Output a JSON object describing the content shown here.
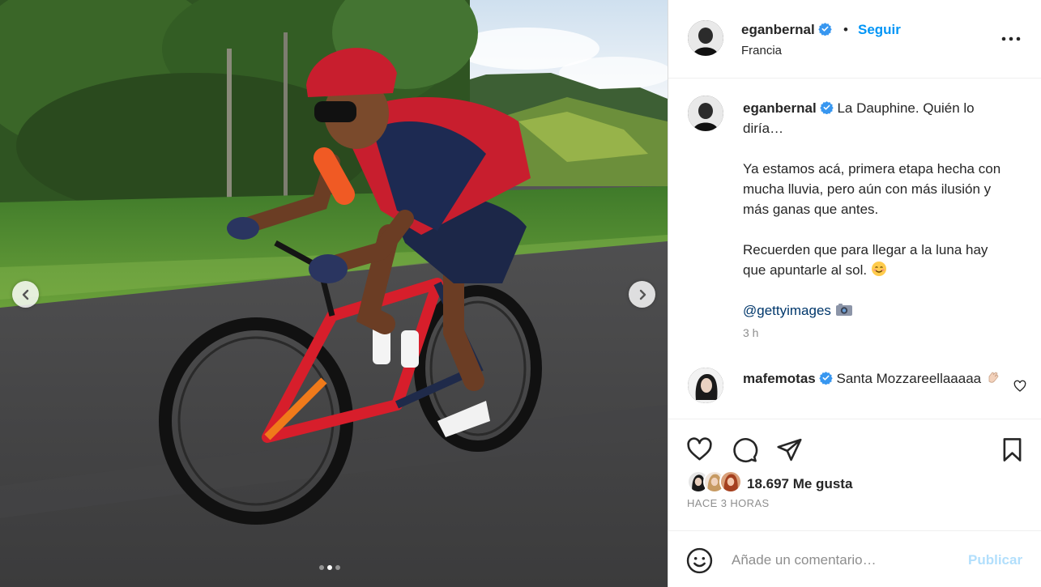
{
  "header": {
    "username": "eganbernal",
    "separator": "•",
    "follow_label": "Seguir",
    "location": "Francia"
  },
  "caption": {
    "username": "eganbernal",
    "line1": "La Dauphine. Quién lo diría…",
    "line2": "Ya estamos acá, primera etapa hecha con mucha lluvia, pero aún con más ilusión y más ganas que antes.",
    "line3": "Recuerden que para llegar a la luna hay que apuntarle al sol.",
    "mention": "@gettyimages",
    "time": "3 h"
  },
  "comment": {
    "username": "mafemotas",
    "text": "Santa Mozzareellaaaaa"
  },
  "actions": {
    "likes": "18.697 Me gusta",
    "time_ago": "HACE 3 HORAS"
  },
  "composer": {
    "placeholder": "Añade un comentario…",
    "publish_label": "Publicar"
  },
  "carousel": {
    "slide_count": 3,
    "active_slide": 2
  },
  "colors": {
    "link_blue": "#0095f6",
    "publish_disabled": "#b2dffc",
    "text": "#262626",
    "muted": "#8e8e8e"
  },
  "icons": [
    "verified-badge-icon",
    "more-options-icon",
    "heart-icon",
    "comment-bubble-icon",
    "share-paper-plane-icon",
    "bookmark-icon",
    "emoji-smiley-icon",
    "chevron-left-icon",
    "chevron-right-icon",
    "camera-emoji-icon",
    "blushing-face-emoji-icon",
    "clapping-hand-emoji-icon"
  ]
}
